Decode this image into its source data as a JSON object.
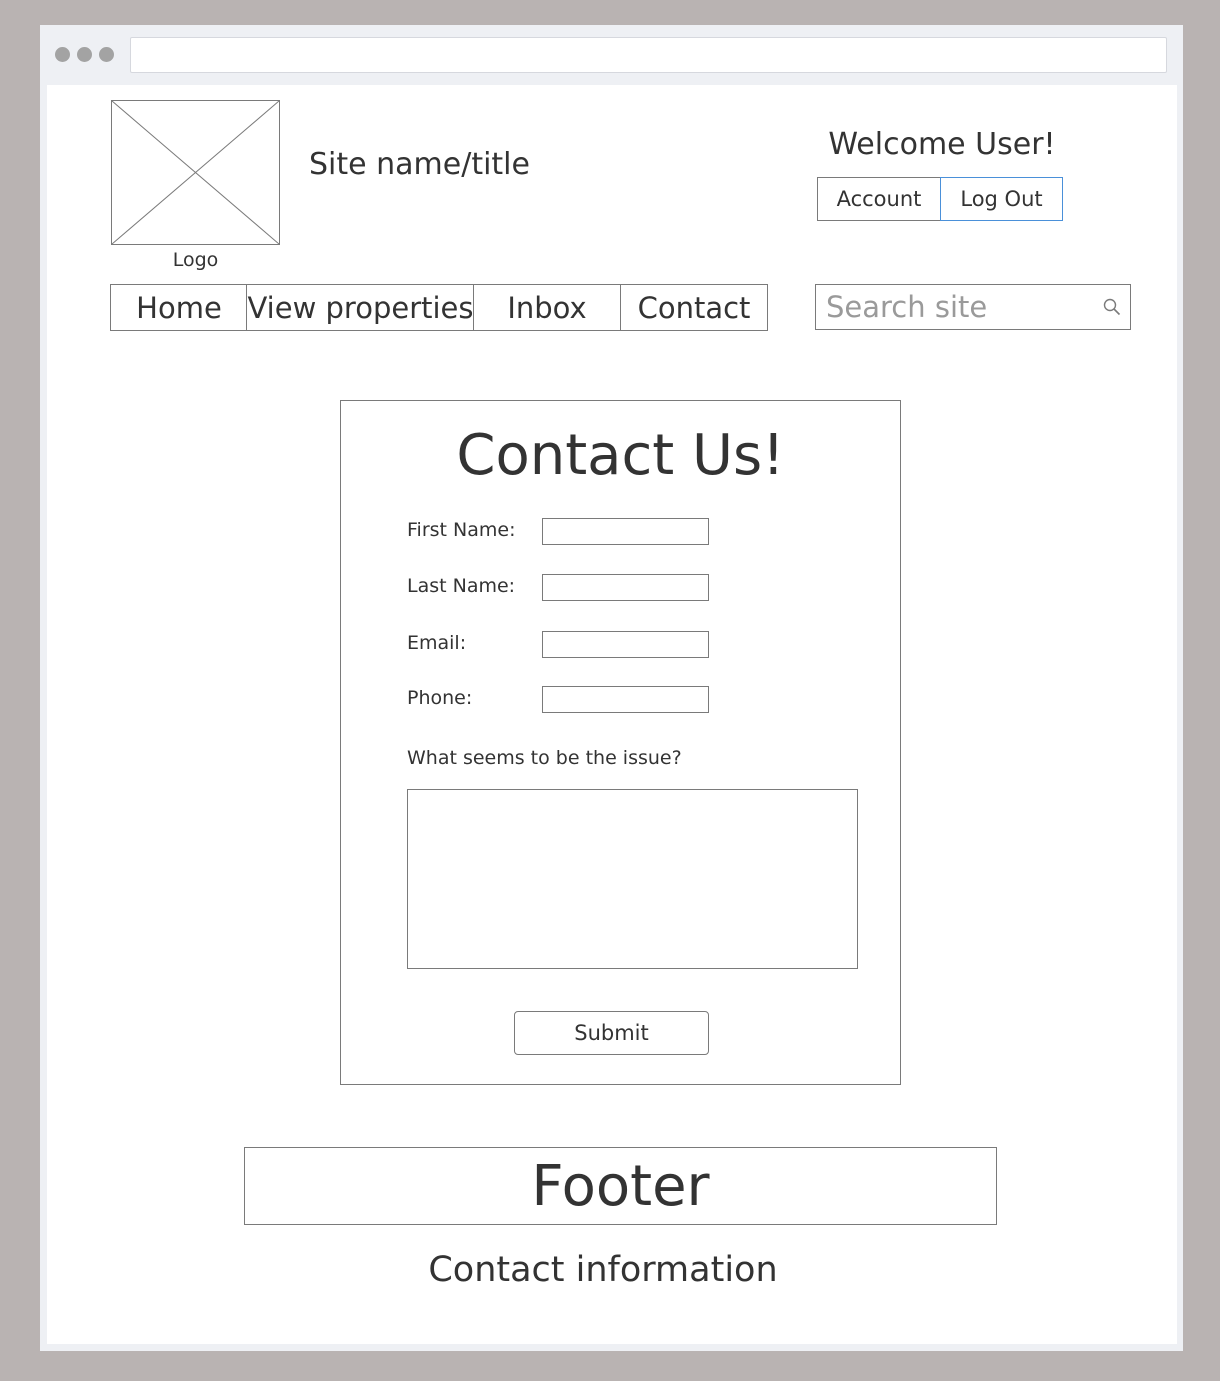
{
  "header": {
    "logo_label": "Logo",
    "site_title": "Site name/title",
    "welcome": "Welcome User!",
    "account_label": "Account",
    "logout_label": "Log Out"
  },
  "nav": {
    "items": [
      {
        "label": "Home"
      },
      {
        "label": "View properties"
      },
      {
        "label": "Inbox"
      },
      {
        "label": "Contact"
      }
    ]
  },
  "search": {
    "placeholder": "Search site",
    "icon": "search-icon"
  },
  "form": {
    "title": "Contact Us!",
    "fields": [
      {
        "label": "First Name:",
        "value": ""
      },
      {
        "label": "Last Name:",
        "value": ""
      },
      {
        "label": "Email:",
        "value": ""
      },
      {
        "label": "Phone:",
        "value": ""
      }
    ],
    "issue_label": "What seems to be the issue?",
    "issue_value": "",
    "submit_label": "Submit"
  },
  "footer": {
    "title": "Footer",
    "contact_info": "Contact information"
  },
  "colors": {
    "backdrop": "#b9b3b2",
    "browser_chrome": "#eef0f4",
    "border": "#7a7a7a",
    "focus_accent": "#4a90d9",
    "text": "#333333",
    "placeholder": "#9a9a9a"
  }
}
